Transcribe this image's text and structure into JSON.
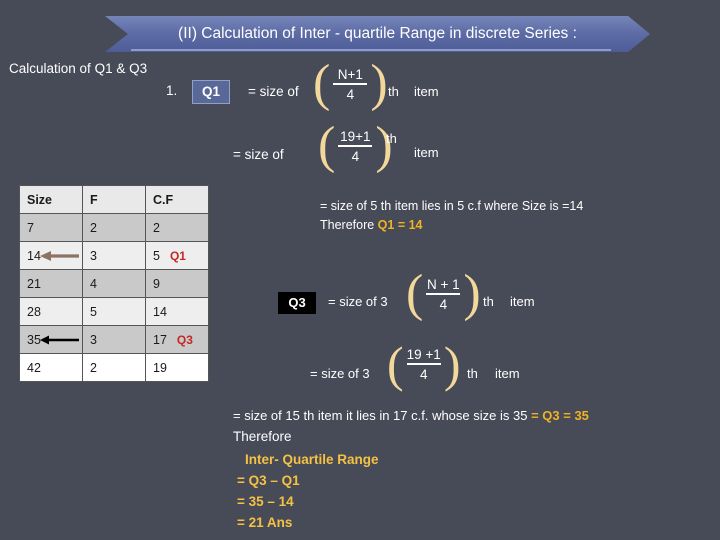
{
  "slide": {
    "background_color": "#474a57",
    "banner_title": "(II) Calculation of  Inter - quartile Range in discrete Series :",
    "banner_color": "#5f6da6"
  },
  "intro": {
    "heading_prefix": "Calculation of ",
    "heading_q1": "Q1",
    "heading_amp": " & ",
    "heading_q3": "Q3"
  },
  "q1_formula": {
    "index": "1.",
    "chip_label": "Q1",
    "chip_bg": "#5a6897",
    "equals_size_of": "= size of",
    "numerator": "N+1",
    "denominator": "4",
    "th": "th",
    "item": "item",
    "second_equals": "= size of",
    "second_numerator": "19+1",
    "second_denominator": "4",
    "second_th": "th",
    "second_item": "item",
    "result_line": "= size of 5 th item lies in 5 c.f where Size is =14",
    "therefore_word": "Therefore ",
    "therefore_value": "Q1 = 14"
  },
  "q3_formula": {
    "chip_label": "Q3",
    "chip_bg": "#000000",
    "equals_size_of": "= size of 3",
    "numerator": "N + 1",
    "denominator": "4",
    "th": "th",
    "item": "item",
    "second_equals": "= size of  3",
    "second_numerator": "19 +1",
    "second_denominator": "4",
    "second_th": "th",
    "second_item": "item",
    "result_line": "= size of 15 th item  it lies in 17 c.f. whose size is 35",
    "result_equals": "= Q3 = 35"
  },
  "conclusion": {
    "therefore": "Therefore",
    "title": "Inter- Quartile Range",
    "line1": "= Q3 – Q1",
    "line2": "= 35 – 14",
    "line3": "= 21 Ans",
    "accent_color": "#f0b323"
  },
  "table": {
    "headers": [
      "Size",
      "F",
      "C.F"
    ],
    "rows": [
      {
        "size": "7",
        "f": "2",
        "cf": "2",
        "mark": "",
        "shade": "r-dark",
        "bold_cf": false,
        "bold_size": false,
        "arrow": ""
      },
      {
        "size": "14",
        "f": "3",
        "cf": "5",
        "mark": "Q1",
        "shade": "r-light",
        "bold_cf": false,
        "bold_size": true,
        "arrow": "brown"
      },
      {
        "size": "21",
        "f": "4",
        "cf": "9",
        "mark": "",
        "shade": "r-dark",
        "bold_cf": false,
        "bold_size": false,
        "arrow": ""
      },
      {
        "size": "28",
        "f": "5",
        "cf": "14",
        "mark": "",
        "shade": "r-light",
        "bold_cf": true,
        "bold_size": false,
        "arrow": ""
      },
      {
        "size": "35",
        "f": "3",
        "cf": "17",
        "mark": "Q3",
        "shade": "r-dark",
        "bold_cf": true,
        "bold_size": false,
        "arrow": "black"
      },
      {
        "size": "42",
        "f": "2",
        "cf": "19",
        "mark": "",
        "shade": "r-white",
        "bold_cf": false,
        "bold_size": false,
        "arrow": ""
      }
    ],
    "mark_color": "#c62828"
  }
}
